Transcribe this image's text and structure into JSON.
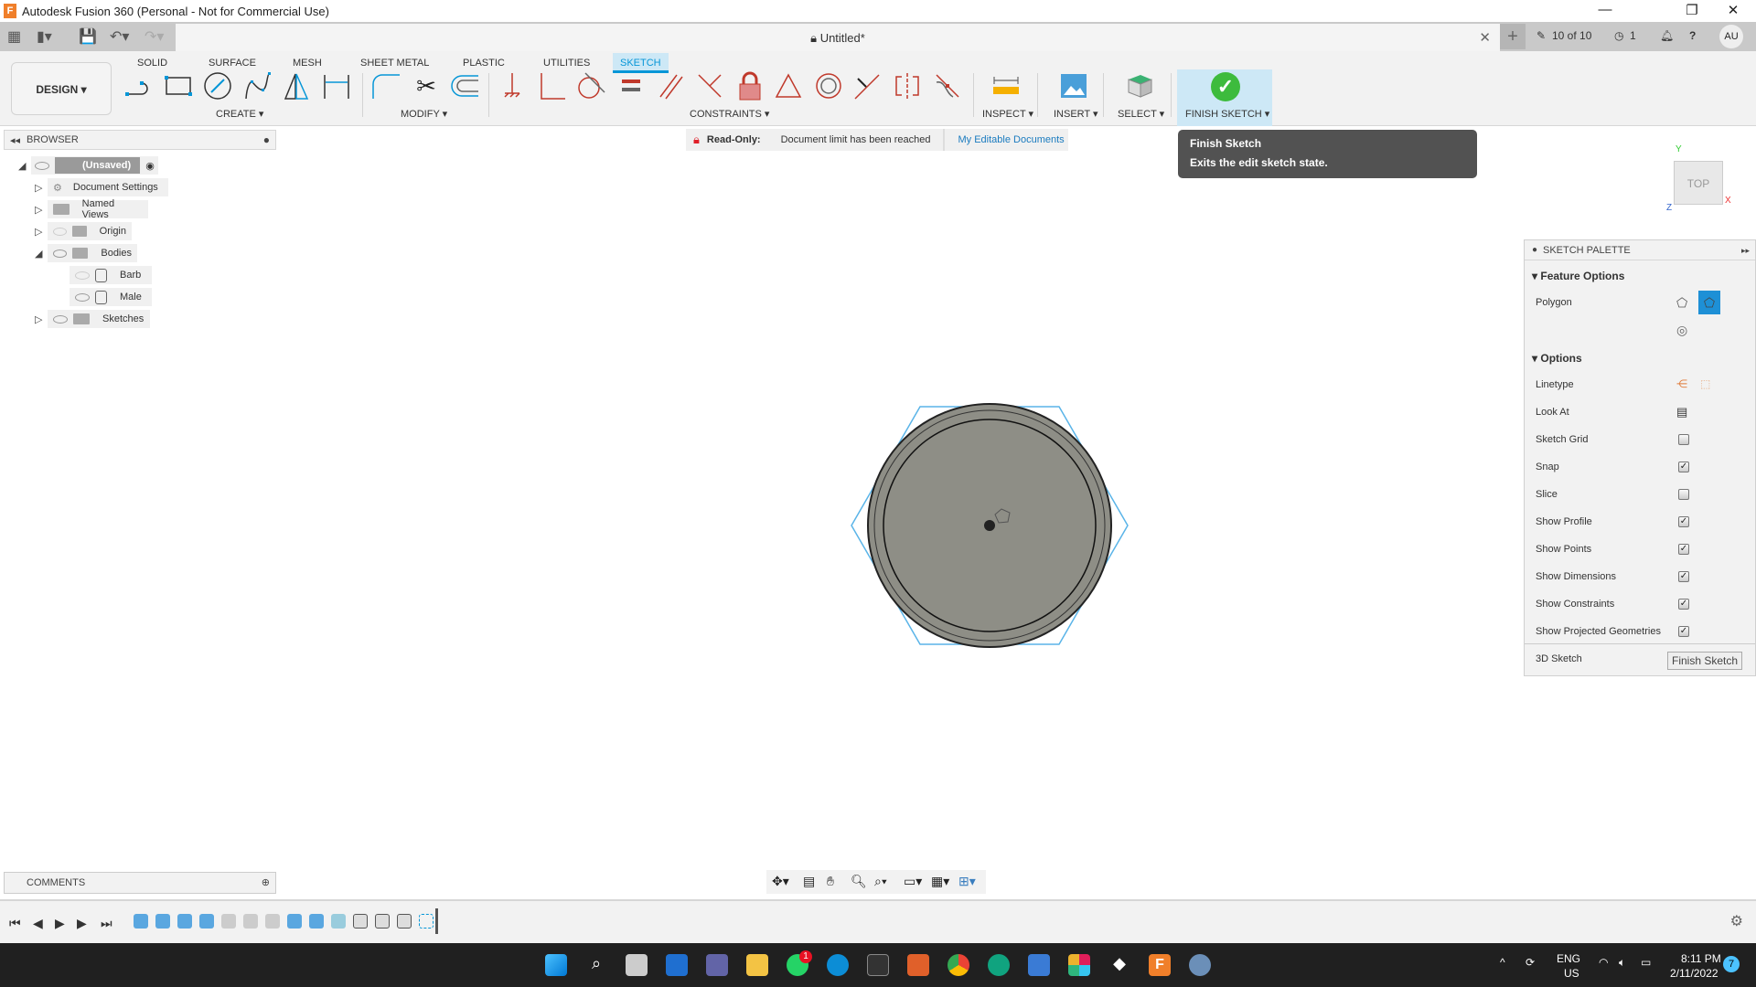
{
  "window": {
    "title": "Autodesk Fusion 360 (Personal - Not for Commercial Use)",
    "minimize": "—",
    "maximize": "❐",
    "close": "✕"
  },
  "doc_tab": {
    "title": "Untitled*",
    "close": "✕",
    "new_tab": "+"
  },
  "header_right": {
    "doc_count": "10 of 10",
    "jobs": "1",
    "avatar": "AU"
  },
  "workspace": {
    "label": "DESIGN ▾"
  },
  "ribbon_tabs": [
    {
      "label": "SOLID",
      "active": false
    },
    {
      "label": "SURFACE",
      "active": false
    },
    {
      "label": "MESH",
      "active": false
    },
    {
      "label": "SHEET METAL",
      "active": false
    },
    {
      "label": "PLASTIC",
      "active": false
    },
    {
      "label": "UTILITIES",
      "active": false
    },
    {
      "label": "SKETCH",
      "active": true
    }
  ],
  "groups": {
    "create": "CREATE ▾",
    "modify": "MODIFY ▾",
    "constraints": "CONSTRAINTS ▾",
    "inspect": "INSPECT ▾",
    "insert": "INSERT ▾",
    "select": "SELECT ▾",
    "finish": "FINISH SKETCH ▾"
  },
  "browser": {
    "title": "BROWSER",
    "root": "(Unsaved)",
    "items": [
      {
        "label": "Document Settings"
      },
      {
        "label": "Named Views"
      },
      {
        "label": "Origin"
      },
      {
        "label": "Bodies"
      },
      {
        "label": "Barb"
      },
      {
        "label": "Male"
      },
      {
        "label": "Sketches"
      }
    ]
  },
  "banner": {
    "label": "Read-Only:",
    "message": "Document limit has been reached",
    "link": "My Editable Documents"
  },
  "tooltip": {
    "title": "Finish Sketch",
    "body": "Exits the edit sketch state."
  },
  "viewcube": {
    "face": "TOP",
    "x": "X",
    "y": "Y",
    "z": "Z"
  },
  "palette": {
    "title": "SKETCH PALETTE",
    "feature_options": "Feature Options",
    "polygon": "Polygon",
    "options": "Options",
    "linetype": "Linetype",
    "look_at": "Look At",
    "checkboxes": [
      {
        "label": "Sketch Grid",
        "checked": false
      },
      {
        "label": "Snap",
        "checked": true
      },
      {
        "label": "Slice",
        "checked": false
      },
      {
        "label": "Show Profile",
        "checked": true
      },
      {
        "label": "Show Points",
        "checked": true
      },
      {
        "label": "Show Dimensions",
        "checked": true
      },
      {
        "label": "Show Constraints",
        "checked": true
      },
      {
        "label": "Show Projected Geometries",
        "checked": true
      },
      {
        "label": "3D Sketch",
        "checked": false
      }
    ],
    "finish_button": "Finish Sketch"
  },
  "comments": {
    "title": "COMMENTS"
  },
  "taskbar": {
    "lang1": "ENG",
    "lang2": "US",
    "time": "8:11 PM",
    "date": "2/11/2022",
    "notifications": "7",
    "whatsapp_badge": "1"
  },
  "colors": {
    "accent": "#0696d7",
    "constraint_red": "#c0392b",
    "tooltip_bg": "#525252"
  }
}
